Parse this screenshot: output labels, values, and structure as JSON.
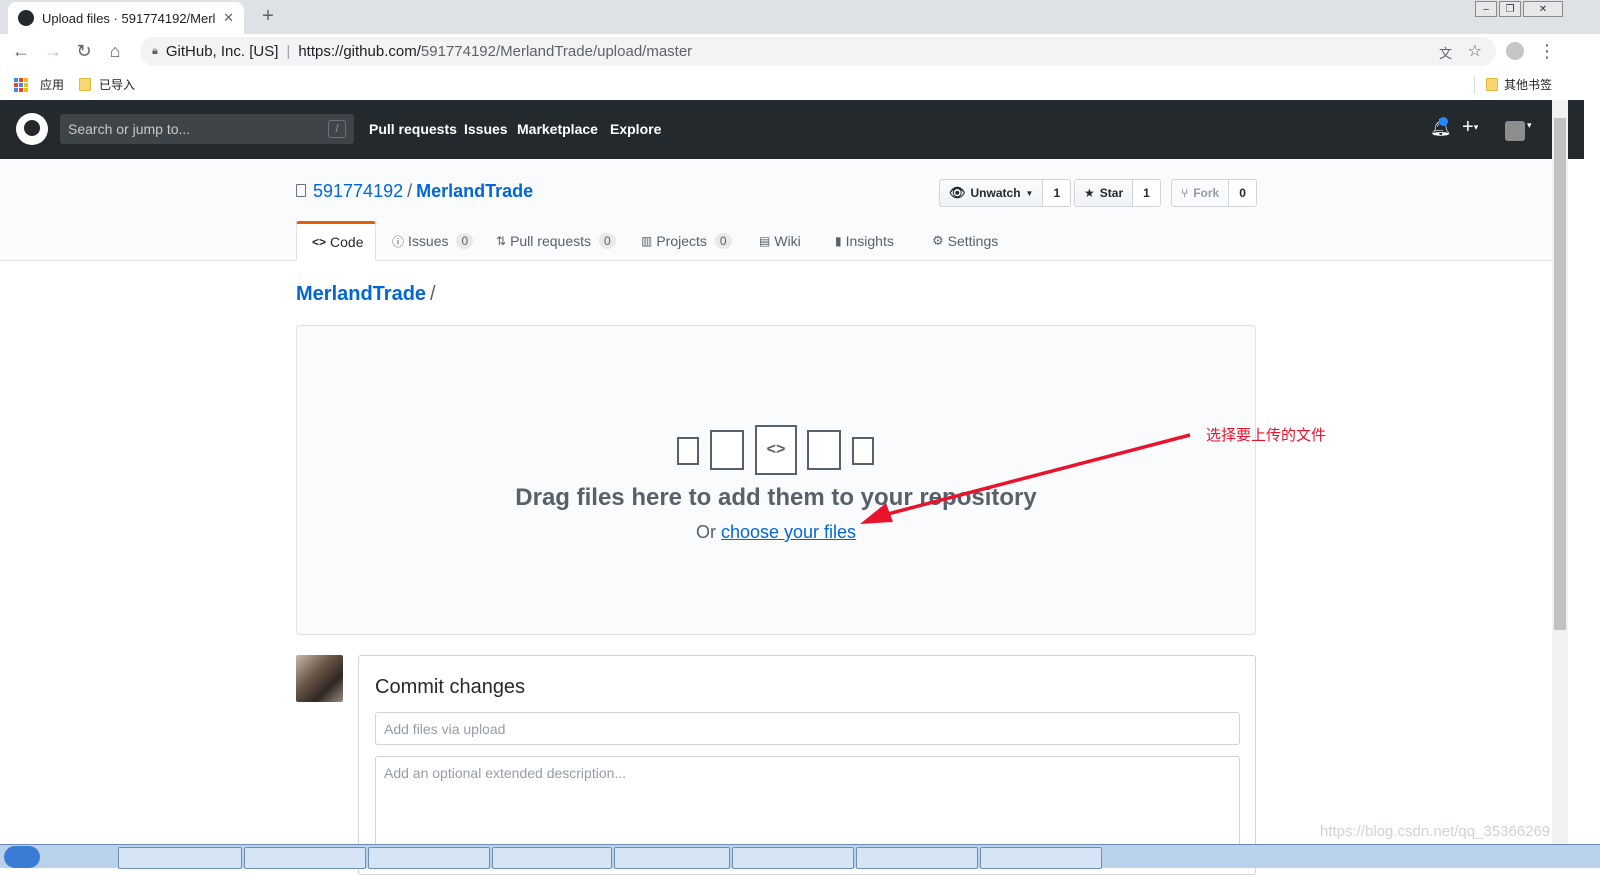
{
  "browser": {
    "tab_title": "Upload files · 591774192/Merl",
    "tab_close": "✕",
    "new_tab": "+",
    "site_identity": "GitHub, Inc. [US]",
    "url_host": "https://github.com/",
    "url_path": "591774192/MerlandTrade/upload/master",
    "bookmarks": [
      "应用",
      "已导入"
    ],
    "other_bookmarks": "其他书签"
  },
  "github_header": {
    "search_placeholder": "Search or jump to...",
    "search_shortcut": "/",
    "nav": [
      "Pull requests",
      "Issues",
      "Marketplace",
      "Explore"
    ]
  },
  "repo": {
    "owner": "591774192",
    "name": "MerlandTrade",
    "watch_label": "Unwatch",
    "watch_count": "1",
    "star_label": "Star",
    "star_count": "1",
    "fork_label": "Fork",
    "fork_count": "0",
    "tabs": {
      "code": "Code",
      "issues": "Issues",
      "issues_count": "0",
      "pulls": "Pull requests",
      "pulls_count": "0",
      "projects": "Projects",
      "projects_count": "0",
      "wiki": "Wiki",
      "insights": "Insights",
      "settings": "Settings"
    }
  },
  "upload": {
    "breadcrumb": "MerlandTrade",
    "breadcrumb_sep": "/",
    "drop_text": "Drag files here to add them to your repository",
    "or_text": "Or",
    "choose_link": "choose your files"
  },
  "annotation": {
    "text": "选择要上传的文件",
    "color": "#e8142d"
  },
  "commit": {
    "title": "Commit changes",
    "message_placeholder": "Add files via upload",
    "description_placeholder": "Add an optional extended description..."
  },
  "watermark": "https://blog.csdn.net/qq_35366269"
}
